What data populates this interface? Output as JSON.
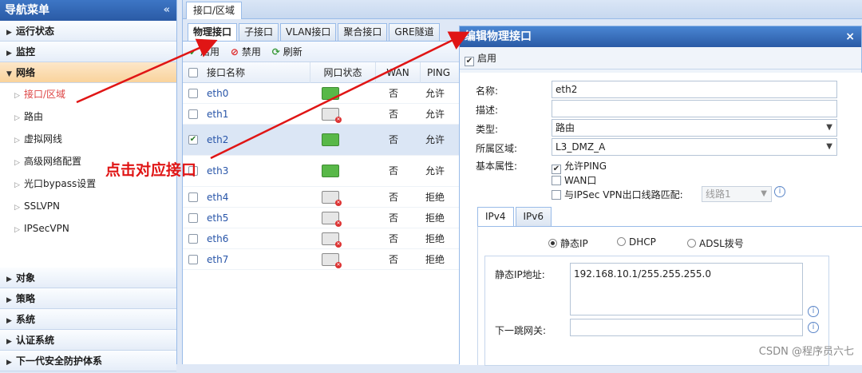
{
  "sidebar": {
    "title": "导航菜单",
    "collapse_glyph": "«",
    "sections_top": [
      {
        "label": "运行状态"
      },
      {
        "label": "监控"
      }
    ],
    "active_section": {
      "label": "网络"
    },
    "items": [
      {
        "label": "接口/区域"
      },
      {
        "label": "路由"
      },
      {
        "label": "虚拟网线"
      },
      {
        "label": "高级网络配置"
      },
      {
        "label": "光口bypass设置"
      },
      {
        "label": "SSLVPN"
      },
      {
        "label": "IPSecVPN"
      }
    ],
    "sections_bottom": [
      {
        "label": "对象"
      },
      {
        "label": "策略"
      },
      {
        "label": "系统"
      },
      {
        "label": "认证系统"
      },
      {
        "label": "下一代安全防护体系"
      }
    ]
  },
  "main": {
    "tab_label": "接口/区域",
    "sub_tabs": [
      "物理接口",
      "子接口",
      "VLAN接口",
      "聚合接口",
      "GRE隧道"
    ],
    "toolbar": {
      "enable": "启用",
      "disable": "禁用",
      "refresh": "刷新"
    },
    "table": {
      "headers": {
        "name": "接口名称",
        "status": "网口状态",
        "wan": "WAN",
        "ping": "PING"
      },
      "rows": [
        {
          "name": "eth0",
          "wan": "否",
          "ping": "允许"
        },
        {
          "name": "eth1",
          "wan": "否",
          "ping": "允许"
        },
        {
          "name": "eth2",
          "wan": "否",
          "ping": "允许"
        },
        {
          "name": "eth3",
          "wan": "否",
          "ping": "允许"
        },
        {
          "name": "eth4",
          "wan": "否",
          "ping": "拒绝"
        },
        {
          "name": "eth5",
          "wan": "否",
          "ping": "拒绝"
        },
        {
          "name": "eth6",
          "wan": "否",
          "ping": "拒绝"
        },
        {
          "name": "eth7",
          "wan": "否",
          "ping": "拒绝"
        }
      ]
    }
  },
  "dialog": {
    "title": "编辑物理接口",
    "close_glyph": "×",
    "enable_label": "启用",
    "form": {
      "name_label": "名称:",
      "name_value": "eth2",
      "desc_label": "描述:",
      "desc_value": "",
      "type_label": "类型:",
      "type_value": "路由",
      "zone_label": "所属区域:",
      "zone_value": "L3_DMZ_A",
      "basic_label": "基本属性:",
      "allow_ping": "允许PING",
      "wan_port": "WAN口",
      "ipsec_match": "与IPSec VPN出口线路匹配:",
      "line_value": "线路1"
    },
    "ip_tabs": [
      "IPv4",
      "IPv6"
    ],
    "ip_modes": [
      "静态IP",
      "DHCP",
      "ADSL拨号"
    ],
    "static_ip_label": "静态IP地址:",
    "static_ip_value": "192.168.10.1/255.255.255.0",
    "next_hop_label": "下一跳网关:",
    "next_hop_value": ""
  },
  "annotation": {
    "text": "点击对应接口",
    "color": "#e01515"
  },
  "watermark": "CSDN @程序员六七",
  "colors": {
    "accent": "#2a5aa5",
    "active_nav": "#f9d39c",
    "port_up": "#58b848",
    "annotation": "#e01515"
  }
}
